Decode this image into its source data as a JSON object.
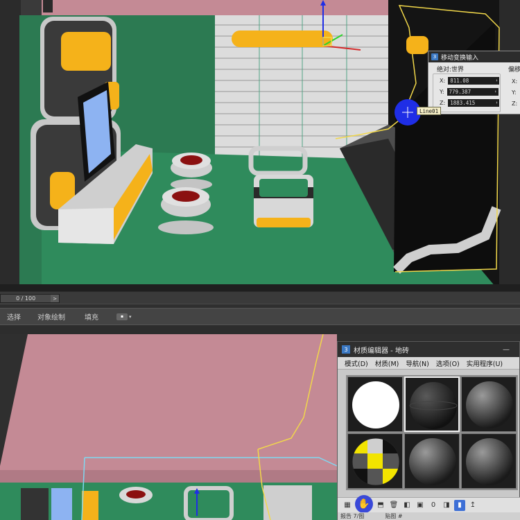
{
  "transform_dialog": {
    "title": "移动变换输入",
    "logo": "3",
    "absolute_label": "绝对:世界",
    "offset_label": "偏移",
    "x_label": "X:",
    "y_label": "Y:",
    "z_label": "Z:",
    "x_value": "811.08",
    "y_value": "779.387",
    "z_value": "1883.415",
    "offset_x_label": "X:",
    "offset_y_label": "Y:",
    "offset_z_label": "Z:"
  },
  "object_tooltip": "Line01",
  "timeline": {
    "frame_text": "0 / 100",
    "next_arrow": ">"
  },
  "ribbon": {
    "items": [
      "选择",
      "对象绘制",
      "填充"
    ]
  },
  "material_editor": {
    "logo": "3",
    "title": "材质编辑器 - 地砖",
    "minimize": "—",
    "menu": [
      "模式(D)",
      "材质(M)",
      "导航(N)",
      "选项(O)",
      "实用程序(U)"
    ],
    "bottom_text_left": "报告  7/图",
    "bottom_text_right": "贴图 #"
  },
  "colors": {
    "floor_green": "#2f8b5c",
    "wall_green": "#2c7a52",
    "pink_ceiling": "#c48a95",
    "accent_yellow": "#f5b21a",
    "gizmo_blue": "#1f2ee6",
    "selection_yellow": "#f2d84a"
  }
}
